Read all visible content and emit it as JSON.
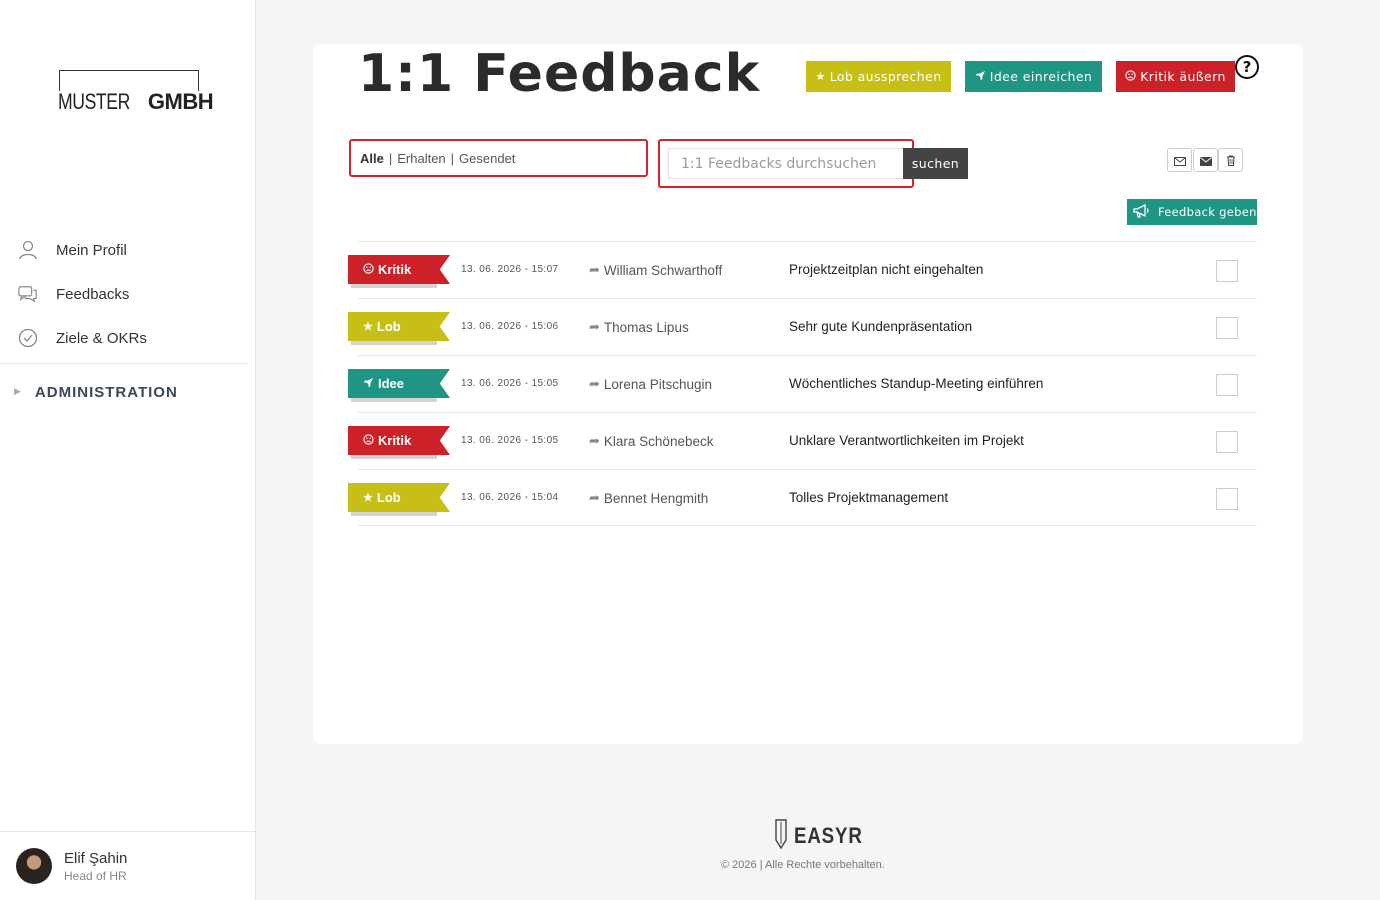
{
  "sidebar": {
    "logo": {
      "part1": "MUSTER",
      "part2": "GMBH"
    },
    "items": [
      {
        "label": "Mein Profil",
        "icon": "user-icon"
      },
      {
        "label": "Feedbacks",
        "icon": "chat-icon"
      },
      {
        "label": "Ziele & OKRs",
        "icon": "check-circle-icon"
      }
    ],
    "admin_label": "ADMINISTRATION",
    "user": {
      "name": "Elif Şahin",
      "role": "Head of HR"
    }
  },
  "main": {
    "title": "1:1 Feedback",
    "buttons": {
      "lob": "Lob aussprechen",
      "idee": "Idee einreichen",
      "kritik": "Kritik äußern",
      "help": "?"
    },
    "filters": {
      "all": "Alle",
      "received": "Erhalten",
      "sent": "Gesendet"
    },
    "search": {
      "placeholder": "1:1 Feedbacks durchsuchen",
      "button": "suchen"
    },
    "give_feedback": "Feedback geben",
    "rows": [
      {
        "type": "Kritik",
        "date": "13. 06. 2026 - 15:07",
        "person": "William Schwarthoff",
        "subject": "Projektzeitplan nicht eingehalten"
      },
      {
        "type": "Lob",
        "date": "13. 06. 2026 - 15:06",
        "person": "Thomas Lipus",
        "subject": "Sehr gute Kundenpräsentation"
      },
      {
        "type": "Idee",
        "date": "13. 06. 2026 - 15:05",
        "person": "Lorena Pitschugin",
        "subject": "Wöchentliches Standup-Meeting einführen"
      },
      {
        "type": "Kritik",
        "date": "13. 06. 2026 - 15:05",
        "person": "Klara Schönebeck",
        "subject": "Unklare Verantwortlichkeiten im Projekt"
      },
      {
        "type": "Lob",
        "date": "13. 06. 2026 - 15:04",
        "person": "Bennet Hengmith",
        "subject": "Tolles Projektmanagement"
      }
    ]
  },
  "colors": {
    "kritik": "#cd2129",
    "lob": "#c8bf16",
    "idee": "#1f9583",
    "dark": "#444444"
  },
  "footer": {
    "brand": "EASYR",
    "copyright": "© 2026 | Alle Rechte vorbehalten."
  }
}
